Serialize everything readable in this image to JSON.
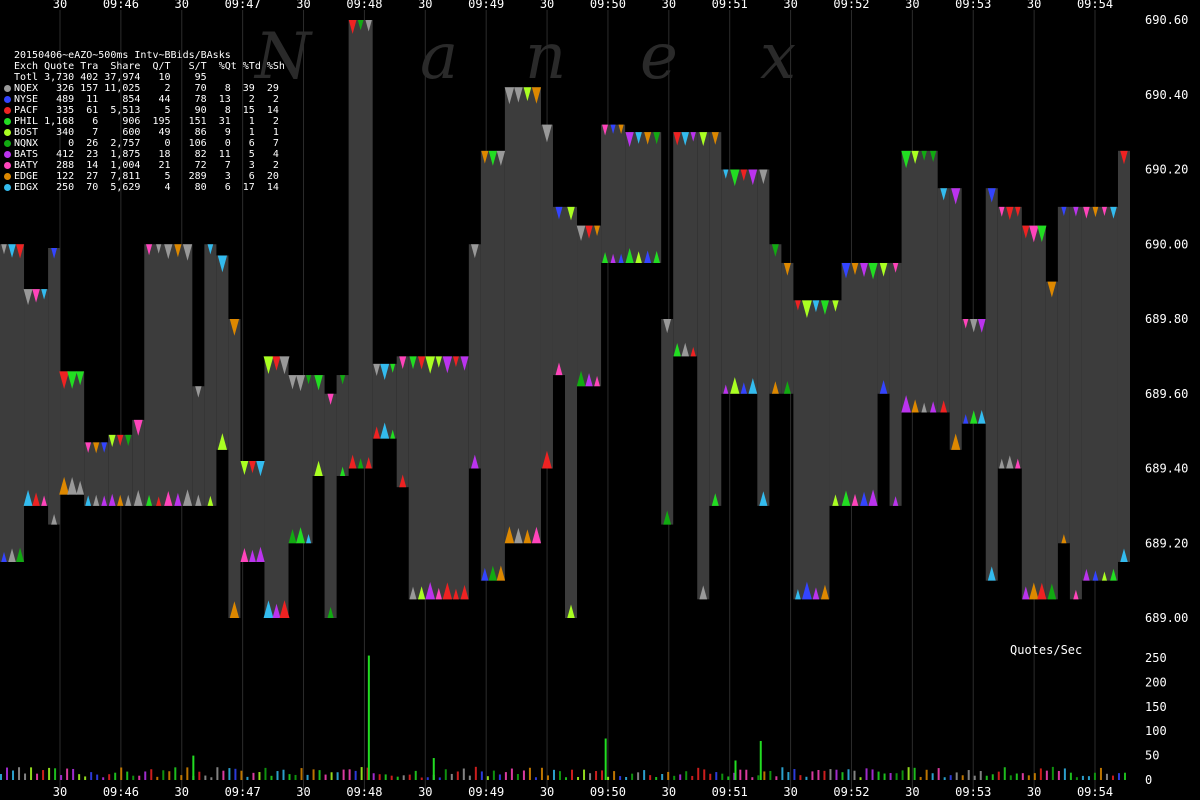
{
  "legend": {
    "title": "20150406~eAZO~500ms Intv~BBids/BAsks",
    "header": "Exch Quote Tra  Share  Q/T   S/T  %Qt %Td %Sh",
    "total_row": "Totl 3,730 402 37,974   10    95",
    "rows": [
      {
        "text": "NQEX   326 157 11,025    2    70   8  39  29",
        "color": "#999999"
      },
      {
        "text": "NYSE   489  11    854   44    78  13   2   2",
        "color": "#3344ff"
      },
      {
        "text": "PACF   335  61  5,513    5    90   8  15  14",
        "color": "#ee2222"
      },
      {
        "text": "PHIL 1,168   6    906  195   151  31   1   2",
        "color": "#22dd22"
      },
      {
        "text": "BOST   340   7    600   49    86   9   1   1",
        "color": "#aaff22"
      },
      {
        "text": "NQNX     0  26  2,757    0   106   0   6   7",
        "color": "#11aa11"
      },
      {
        "text": "BATS   412  23  1,875   18    82  11   5   4",
        "color": "#bb33ee"
      },
      {
        "text": "BATY   288  14  1,004   21    72   7   3   2",
        "color": "#ff44bb"
      },
      {
        "text": "EDGE   122  27  7,811    5   289   3   6  20",
        "color": "#dd8800"
      },
      {
        "text": "EDGX   250  70  5,629    4    80   6  17  14",
        "color": "#33bbee"
      }
    ]
  },
  "watermark": "Nanex",
  "quotes_label": "Quotes/Sec",
  "chart_data": {
    "type": "area",
    "title": "20150406~eAZO~500ms Intv~BBids/BAsks",
    "x_tick_labels": [
      "30",
      "09:46",
      "30",
      "09:47",
      "30",
      "09:48",
      "30",
      "09:49",
      "30",
      "09:50",
      "30",
      "09:51",
      "30",
      "09:52",
      "30",
      "09:53",
      "30",
      "09:54"
    ],
    "price_ticks": [
      "690.60",
      "690.40",
      "690.20",
      "690.00",
      "689.80",
      "689.60",
      "689.40",
      "689.20",
      "689.00"
    ],
    "price_range": [
      688.98,
      690.6
    ],
    "volume_ticks": [
      "250",
      "200",
      "150",
      "100",
      "50",
      "0"
    ],
    "volume_range": [
      0,
      260
    ],
    "spread_bands": [
      {
        "bid": 689.15,
        "ask": 690.0,
        "span": [
          0,
          2
        ]
      },
      {
        "bid": 689.3,
        "ask": 689.88,
        "span": [
          2,
          4
        ]
      },
      {
        "bid": 689.25,
        "ask": 689.99,
        "span": [
          4,
          5
        ]
      },
      {
        "bid": 689.33,
        "ask": 689.66,
        "span": [
          5,
          7
        ]
      },
      {
        "bid": 689.3,
        "ask": 689.47,
        "span": [
          7,
          9
        ]
      },
      {
        "bid": 689.3,
        "ask": 689.49,
        "span": [
          9,
          11
        ]
      },
      {
        "bid": 689.3,
        "ask": 689.53,
        "span": [
          11,
          12
        ]
      },
      {
        "bid": 689.3,
        "ask": 690.0,
        "span": [
          12,
          16
        ]
      },
      {
        "bid": 689.3,
        "ask": 689.62,
        "span": [
          16,
          17
        ]
      },
      {
        "bid": 689.3,
        "ask": 690.0,
        "span": [
          17,
          18
        ]
      },
      {
        "bid": 689.45,
        "ask": 689.97,
        "span": [
          18,
          19
        ]
      },
      {
        "bid": 689.0,
        "ask": 689.8,
        "span": [
          19,
          20
        ]
      },
      {
        "bid": 689.15,
        "ask": 689.42,
        "span": [
          20,
          22
        ]
      },
      {
        "bid": 689.0,
        "ask": 689.7,
        "span": [
          22,
          24
        ]
      },
      {
        "bid": 689.2,
        "ask": 689.65,
        "span": [
          24,
          26
        ]
      },
      {
        "bid": 689.38,
        "ask": 689.65,
        "span": [
          26,
          27
        ]
      },
      {
        "bid": 689.0,
        "ask": 689.6,
        "span": [
          27,
          28
        ]
      },
      {
        "bid": 689.38,
        "ask": 689.65,
        "span": [
          28,
          29
        ]
      },
      {
        "bid": 689.4,
        "ask": 690.7,
        "span": [
          29,
          31
        ]
      },
      {
        "bid": 689.48,
        "ask": 689.68,
        "span": [
          31,
          33
        ]
      },
      {
        "bid": 689.35,
        "ask": 689.7,
        "span": [
          33,
          34
        ]
      },
      {
        "bid": 689.05,
        "ask": 689.7,
        "span": [
          34,
          39
        ]
      },
      {
        "bid": 689.4,
        "ask": 690.0,
        "span": [
          39,
          40
        ]
      },
      {
        "bid": 689.1,
        "ask": 690.25,
        "span": [
          40,
          42
        ]
      },
      {
        "bid": 689.2,
        "ask": 690.42,
        "span": [
          42,
          45
        ]
      },
      {
        "bid": 689.4,
        "ask": 690.32,
        "span": [
          45,
          46
        ]
      },
      {
        "bid": 689.65,
        "ask": 690.1,
        "span": [
          46,
          47
        ]
      },
      {
        "bid": 689.0,
        "ask": 690.1,
        "span": [
          47,
          48
        ]
      },
      {
        "bid": 689.62,
        "ask": 690.05,
        "span": [
          48,
          50
        ]
      },
      {
        "bid": 689.95,
        "ask": 690.32,
        "span": [
          50,
          52
        ]
      },
      {
        "bid": 689.95,
        "ask": 690.3,
        "span": [
          52,
          55
        ]
      },
      {
        "bid": 689.25,
        "ask": 689.8,
        "span": [
          55,
          56
        ]
      },
      {
        "bid": 689.7,
        "ask": 690.3,
        "span": [
          56,
          58
        ]
      },
      {
        "bid": 689.05,
        "ask": 690.3,
        "span": [
          58,
          59
        ]
      },
      {
        "bid": 689.3,
        "ask": 690.3,
        "span": [
          59,
          60
        ]
      },
      {
        "bid": 689.6,
        "ask": 690.2,
        "span": [
          60,
          63
        ]
      },
      {
        "bid": 689.3,
        "ask": 690.2,
        "span": [
          63,
          64
        ]
      },
      {
        "bid": 689.6,
        "ask": 690.0,
        "span": [
          64,
          65
        ]
      },
      {
        "bid": 689.6,
        "ask": 689.95,
        "span": [
          65,
          66
        ]
      },
      {
        "bid": 689.05,
        "ask": 689.85,
        "span": [
          66,
          69
        ]
      },
      {
        "bid": 689.3,
        "ask": 689.85,
        "span": [
          69,
          70
        ]
      },
      {
        "bid": 689.3,
        "ask": 689.95,
        "span": [
          70,
          73
        ]
      },
      {
        "bid": 689.6,
        "ask": 689.95,
        "span": [
          73,
          74
        ]
      },
      {
        "bid": 689.3,
        "ask": 689.95,
        "span": [
          74,
          75
        ]
      },
      {
        "bid": 689.55,
        "ask": 690.25,
        "span": [
          75,
          78
        ]
      },
      {
        "bid": 689.55,
        "ask": 690.15,
        "span": [
          78,
          79
        ]
      },
      {
        "bid": 689.45,
        "ask": 690.15,
        "span": [
          79,
          80
        ]
      },
      {
        "bid": 689.52,
        "ask": 689.8,
        "span": [
          80,
          82
        ]
      },
      {
        "bid": 689.1,
        "ask": 690.15,
        "span": [
          82,
          83
        ]
      },
      {
        "bid": 689.4,
        "ask": 690.1,
        "span": [
          83,
          85
        ]
      },
      {
        "bid": 689.05,
        "ask": 690.05,
        "span": [
          85,
          87
        ]
      },
      {
        "bid": 689.05,
        "ask": 689.9,
        "span": [
          87,
          88
        ]
      },
      {
        "bid": 689.2,
        "ask": 690.1,
        "span": [
          88,
          89
        ]
      },
      {
        "bid": 689.05,
        "ask": 690.1,
        "span": [
          89,
          90
        ]
      },
      {
        "bid": 689.1,
        "ask": 690.1,
        "span": [
          90,
          93
        ]
      },
      {
        "bid": 689.15,
        "ask": 690.25,
        "span": [
          93,
          94
        ]
      }
    ],
    "volume_spikes": [
      {
        "at": 30.6,
        "value": 255
      },
      {
        "at": 50.3,
        "value": 85
      },
      {
        "at": 63.2,
        "value": 80
      },
      {
        "at": 16.0,
        "value": 50
      },
      {
        "at": 36.0,
        "value": 45
      },
      {
        "at": 61.1,
        "value": 40
      }
    ]
  }
}
